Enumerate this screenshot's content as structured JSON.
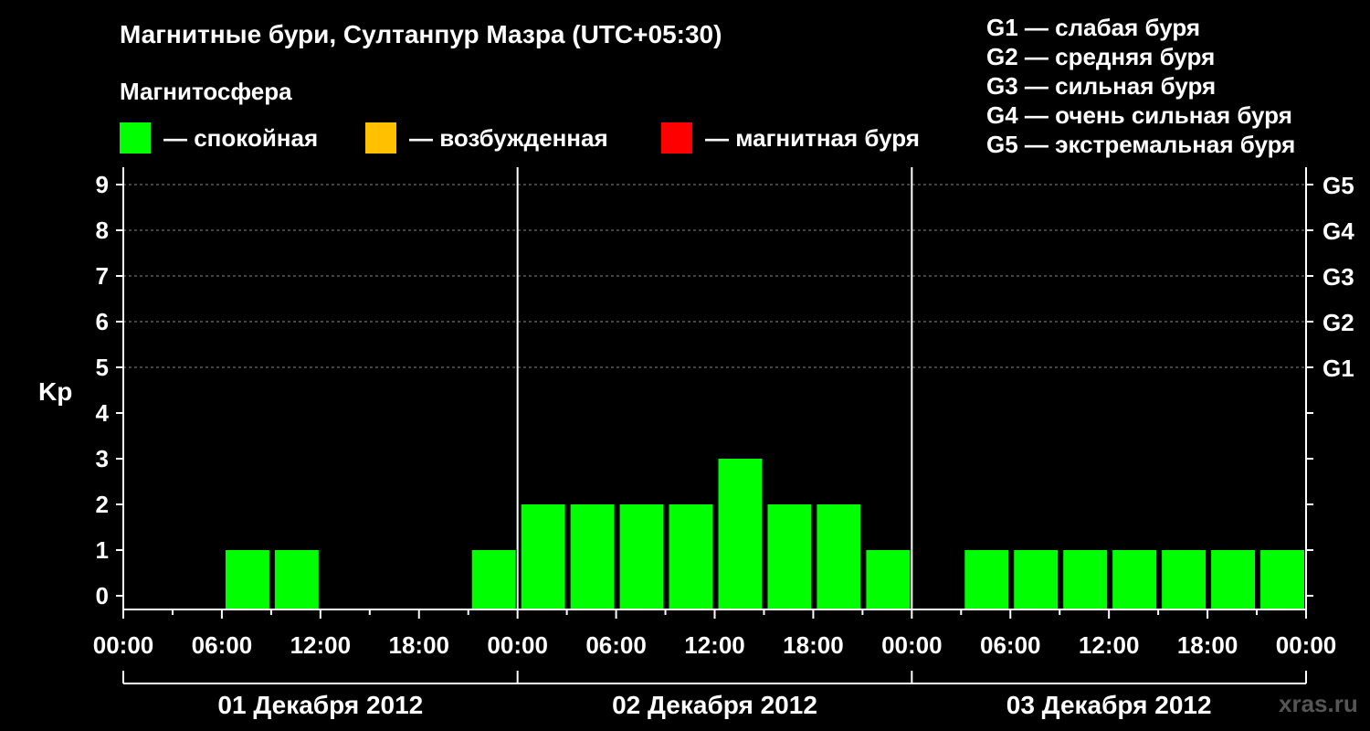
{
  "header": {
    "title": "Магнитные бури, Султанпур Мазра (UTC+05:30)",
    "subtitle": "Магнитосфера"
  },
  "legend": [
    {
      "label": "— спокойная",
      "color": "#00ff00"
    },
    {
      "label": "— возбужденная",
      "color": "#ffc000"
    },
    {
      "label": "— магнитная буря",
      "color": "#ff0000"
    }
  ],
  "g_legend": [
    "G1 — слабая буря",
    "G2 — средняя буря",
    "G3 — сильная буря",
    "G4 — очень сильная буря",
    "G5 — экстремальная буря"
  ],
  "watermark": "xras.ru",
  "chart_data": {
    "type": "bar",
    "ylabel": "Kp",
    "ylim": [
      0,
      9
    ],
    "yticks": [
      "0",
      "1",
      "2",
      "3",
      "4",
      "5",
      "6",
      "7",
      "8",
      "9"
    ],
    "right_ticks": [
      {
        "value": 5,
        "label": "G1"
      },
      {
        "value": 6,
        "label": "G2"
      },
      {
        "value": 7,
        "label": "G3"
      },
      {
        "value": 8,
        "label": "G4"
      },
      {
        "value": 9,
        "label": "G5"
      }
    ],
    "grid": "horizontal dashed at 5-9",
    "xticks": [
      "00:00",
      "06:00",
      "12:00",
      "18:00",
      "00:00",
      "06:00",
      "12:00",
      "18:00",
      "00:00",
      "06:00",
      "12:00",
      "18:00",
      "00:00"
    ],
    "days": [
      "01 Декабря 2012",
      "02 Декабря 2012",
      "03 Декабря 2012"
    ],
    "bar_color": "#00ff00",
    "series": [
      {
        "day": "01 Декабря 2012",
        "hours": [
          "00:00",
          "03:00",
          "06:00",
          "09:00",
          "12:00",
          "15:00",
          "18:00",
          "21:00"
        ],
        "values": [
          0,
          0,
          1,
          1,
          0,
          0,
          0,
          1
        ]
      },
      {
        "day": "02 Декабря 2012",
        "hours": [
          "00:00",
          "03:00",
          "06:00",
          "09:00",
          "12:00",
          "15:00",
          "18:00",
          "21:00"
        ],
        "values": [
          2,
          2,
          2,
          2,
          3,
          2,
          2,
          1
        ]
      },
      {
        "day": "03 Декабря 2012",
        "hours": [
          "00:00",
          "03:00",
          "06:00",
          "09:00",
          "12:00",
          "15:00",
          "18:00",
          "21:00"
        ],
        "values": [
          0,
          1,
          1,
          1,
          1,
          1,
          1,
          1
        ]
      }
    ]
  }
}
